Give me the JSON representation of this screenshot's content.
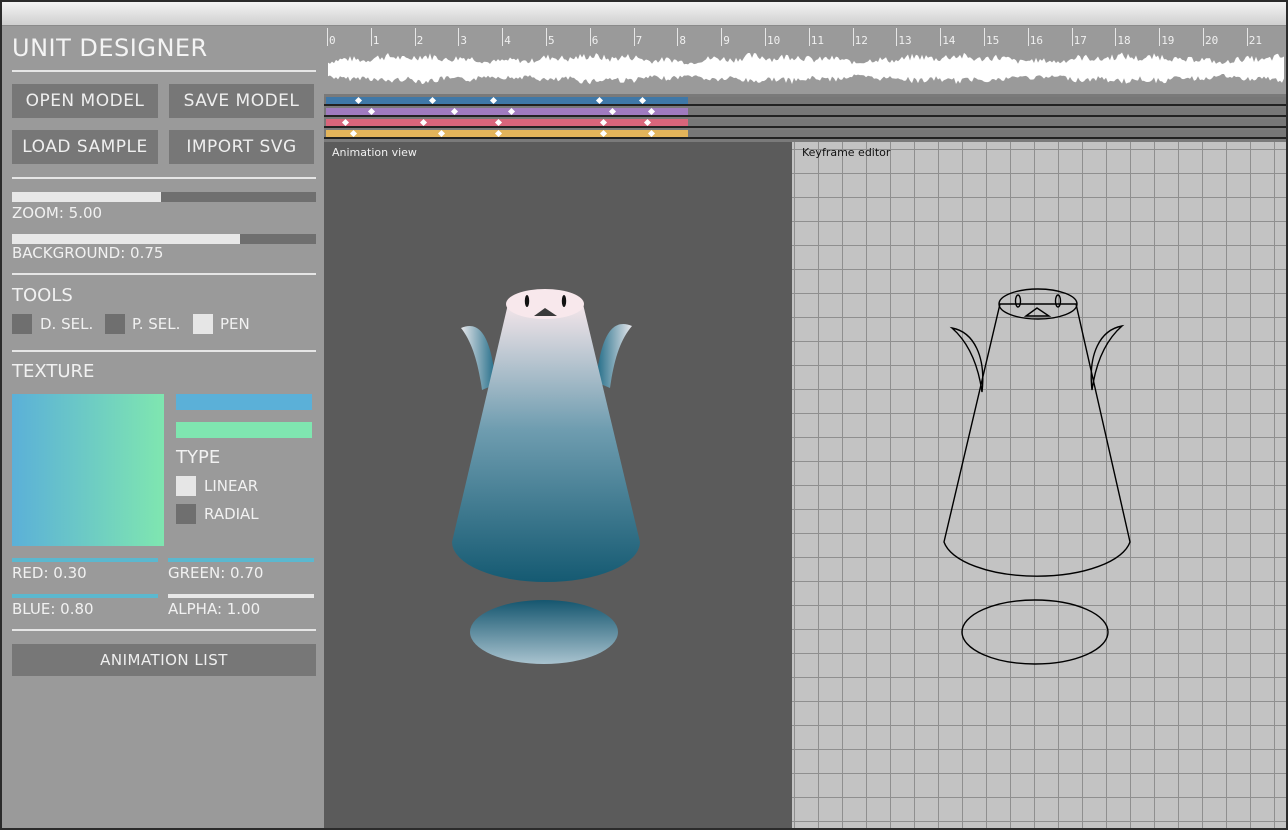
{
  "app": {
    "title": "UNIT DESIGNER"
  },
  "buttons": {
    "open_model": "OPEN MODEL",
    "save_model": "SAVE MODEL",
    "load_sample": "LOAD SAMPLE",
    "import_svg": "IMPORT SVG",
    "animation_list": "ANIMATION LIST"
  },
  "sliders": {
    "zoom": {
      "label": "ZOOM: 5.00",
      "fraction": 0.49
    },
    "background": {
      "label": "BACKGROUND: 0.75",
      "fraction": 0.75
    }
  },
  "tools": {
    "title": "TOOLS",
    "items": [
      {
        "label": "D. SEL.",
        "active": false
      },
      {
        "label": "P. SEL.",
        "active": false
      },
      {
        "label": "PEN",
        "active": true
      }
    ]
  },
  "texture": {
    "title": "TEXTURE",
    "color_start": "#5bb0d8",
    "color_end": "#7fe6b0",
    "type_title": "TYPE",
    "types": [
      {
        "label": "LINEAR",
        "active": true
      },
      {
        "label": "RADIAL",
        "active": false
      }
    ],
    "channels": {
      "red": "RED: 0.30",
      "green": "GREEN: 0.70",
      "blue": "BLUE: 0.80",
      "alpha": "ALPHA: 1.00"
    }
  },
  "timeline": {
    "ticks": [
      "0",
      "1",
      "2",
      "3",
      "4",
      "5",
      "6",
      "7",
      "8",
      "9",
      "10",
      "11",
      "12",
      "13",
      "14",
      "15",
      "16",
      "17",
      "18",
      "19",
      "20",
      "21"
    ],
    "tracks": [
      {
        "color": "#3f78a8",
        "keyframes": [
          0.7,
          2.4,
          3.8,
          6.2,
          7.2
        ]
      },
      {
        "color": "#a07bbf",
        "keyframes": [
          1.0,
          2.9,
          4.2,
          6.5,
          7.4
        ]
      },
      {
        "color": "#d9657b",
        "keyframes": [
          0.4,
          2.2,
          3.9,
          6.3,
          7.3
        ]
      },
      {
        "color": "#e3b45a",
        "keyframes": [
          0.6,
          2.6,
          3.9,
          6.3,
          7.4
        ]
      }
    ]
  },
  "views": {
    "animation": "Animation view",
    "keyframe": "Keyframe editor"
  }
}
